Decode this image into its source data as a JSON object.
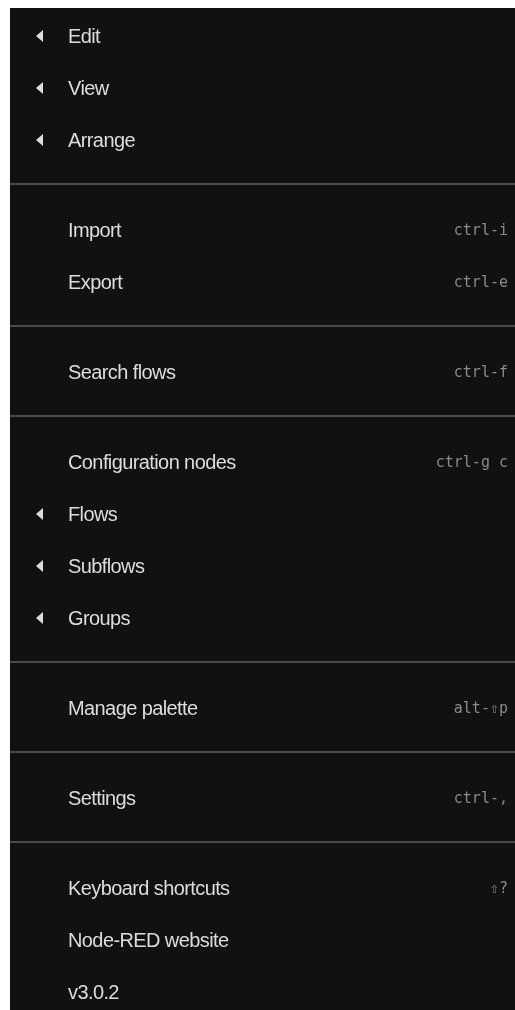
{
  "menu": {
    "sections": [
      {
        "items": [
          {
            "label": "Edit",
            "submenu": true
          },
          {
            "label": "View",
            "submenu": true
          },
          {
            "label": "Arrange",
            "submenu": true
          }
        ]
      },
      {
        "items": [
          {
            "label": "Import",
            "submenu": false,
            "shortcut": "ctrl-i"
          },
          {
            "label": "Export",
            "submenu": false,
            "shortcut": "ctrl-e"
          }
        ]
      },
      {
        "items": [
          {
            "label": "Search flows",
            "submenu": false,
            "shortcut": "ctrl-f"
          }
        ]
      },
      {
        "items": [
          {
            "label": "Configuration nodes",
            "submenu": false,
            "shortcut": "ctrl-g c"
          },
          {
            "label": "Flows",
            "submenu": true
          },
          {
            "label": "Subflows",
            "submenu": true
          },
          {
            "label": "Groups",
            "submenu": true
          }
        ]
      },
      {
        "items": [
          {
            "label": "Manage palette",
            "submenu": false,
            "shortcut": "alt-⇧p"
          }
        ]
      },
      {
        "items": [
          {
            "label": "Settings",
            "submenu": false,
            "shortcut": "ctrl-,"
          }
        ]
      },
      {
        "items": [
          {
            "label": "Keyboard shortcuts",
            "submenu": false,
            "shortcut": "⇧?"
          },
          {
            "label": "Node-RED website",
            "submenu": false
          },
          {
            "label": "v3.0.2",
            "submenu": false
          }
        ]
      }
    ]
  }
}
